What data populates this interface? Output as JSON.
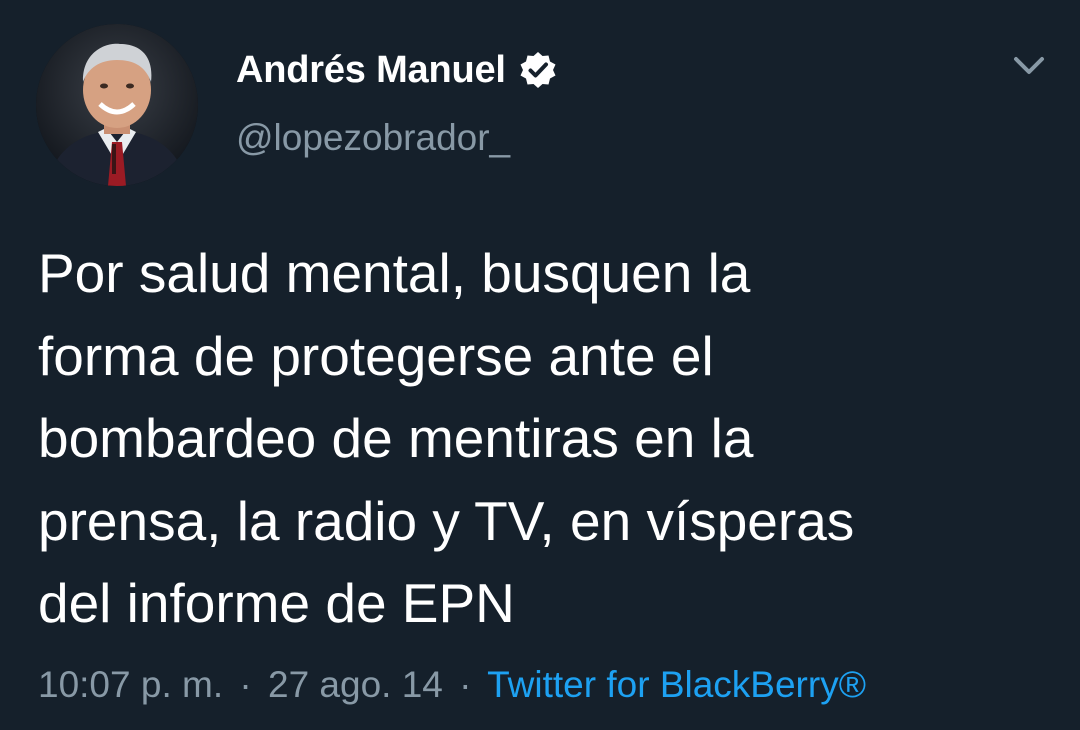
{
  "tweet": {
    "author": {
      "display_name": "Andrés Manuel",
      "handle": "@lopezobrador_",
      "verified": true,
      "avatar_icon": "profile-photo"
    },
    "text": "Por salud mental, busquen la\nforma de protegerse ante el\nbombardeo de mentiras en la\nprensa, la radio y TV, en vísperas\ndel informe de EPN",
    "time": "10:07 p. m.",
    "separator": "·",
    "date": "27 ago. 14",
    "source": "Twitter for BlackBerry®",
    "menu_icon": "chevron-down-icon"
  },
  "colors": {
    "background": "#15202b",
    "primary_text": "#ffffff",
    "secondary_text": "#8899a6",
    "link": "#1da1f2"
  }
}
